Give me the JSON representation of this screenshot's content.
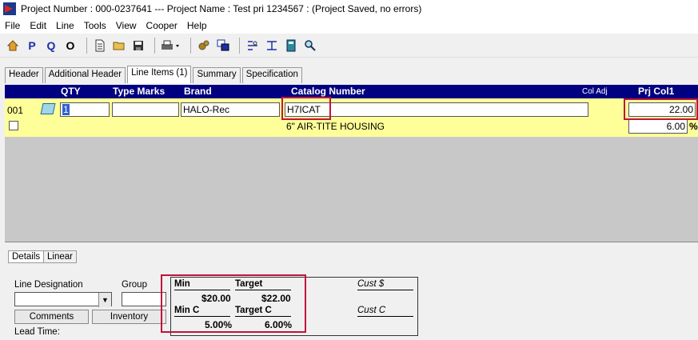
{
  "window": {
    "title": "Project Number : 000-0237641 --- Project Name : Test pri 1234567 : (Project Saved, no errors)"
  },
  "menu": [
    "File",
    "Edit",
    "Line",
    "Tools",
    "View",
    "Cooper",
    "Help"
  ],
  "toolbar": {
    "p_label": "P",
    "q_label": "Q",
    "o_label": "O"
  },
  "tabs": [
    "Header",
    "Additional Header",
    "Line Items (1)",
    "Summary",
    "Specification"
  ],
  "grid": {
    "headers": {
      "qty": "QTY",
      "type_marks": "Type Marks",
      "brand": "Brand",
      "catalog": "Catalog Number",
      "col_adj": "Col Adj",
      "prj_col1": "Prj Col1"
    },
    "row": {
      "line_no": "001",
      "qty": "1",
      "type_marks": "",
      "brand": "HALO-Rec",
      "catalog": "H7ICAT",
      "description": "6\" AIR-TITE HOUSING",
      "prj_col1": "22.00",
      "percent": "6.00",
      "percent_sign": "%"
    }
  },
  "bottom": {
    "tabs": [
      "Details",
      "Linear"
    ],
    "line_designation_label": "Line Designation",
    "group_label": "Group",
    "comments_label": "Comments",
    "inventory_label": "Inventory",
    "lead_time_label": "Lead Time:"
  },
  "pricing": {
    "min_label": "Min",
    "target_label": "Target",
    "cust_dollar_label": "Cust $",
    "min_value": "$20.00",
    "target_value": "$22.00",
    "min_c_label": "Min C",
    "target_c_label": "Target C",
    "cust_c_label": "Cust C",
    "min_c_value": "5.00%",
    "target_c_value": "6.00%"
  },
  "colors": {
    "header_bg": "#000080",
    "row_bg": "#ffff99",
    "highlight": "#c0143c"
  }
}
